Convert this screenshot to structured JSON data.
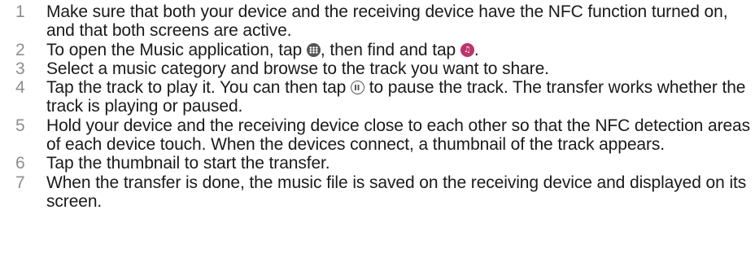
{
  "steps": [
    {
      "number": "1",
      "text": "Make sure that both your device and the receiving device have the NFC function turned on, and that both screens are active."
    },
    {
      "number": "2",
      "text_before_apps_icon": "To open the Music application, tap ",
      "text_between_icons": ", then find and tap ",
      "text_after_music_icon": ".",
      "apps_icon": "apps-grid-icon",
      "music_icon": "music-note-icon"
    },
    {
      "number": "3",
      "text": "Select a music category and browse to the track you want to share."
    },
    {
      "number": "4",
      "text_before_pause_icon": "Tap the track to play it. You can then tap ",
      "text_after_pause_icon": " to pause the track. The transfer works whether the track is playing or paused.",
      "pause_icon": "pause-icon"
    },
    {
      "number": "5",
      "text": "Hold your device and the receiving device close to each other so that the NFC detection areas of each device touch. When the devices connect, a thumbnail of the track appears."
    },
    {
      "number": "6",
      "text": "Tap the thumbnail to start the transfer."
    },
    {
      "number": "7",
      "text": "When the transfer is done, the music file is saved on the receiving device and displayed on its screen."
    }
  ],
  "colors": {
    "text": "#1a1a1a",
    "step_number": "#8e8e8e",
    "apps_icon": "#545454",
    "music_icon": "#c1326a",
    "pause_icon": "#5a5a5a"
  }
}
